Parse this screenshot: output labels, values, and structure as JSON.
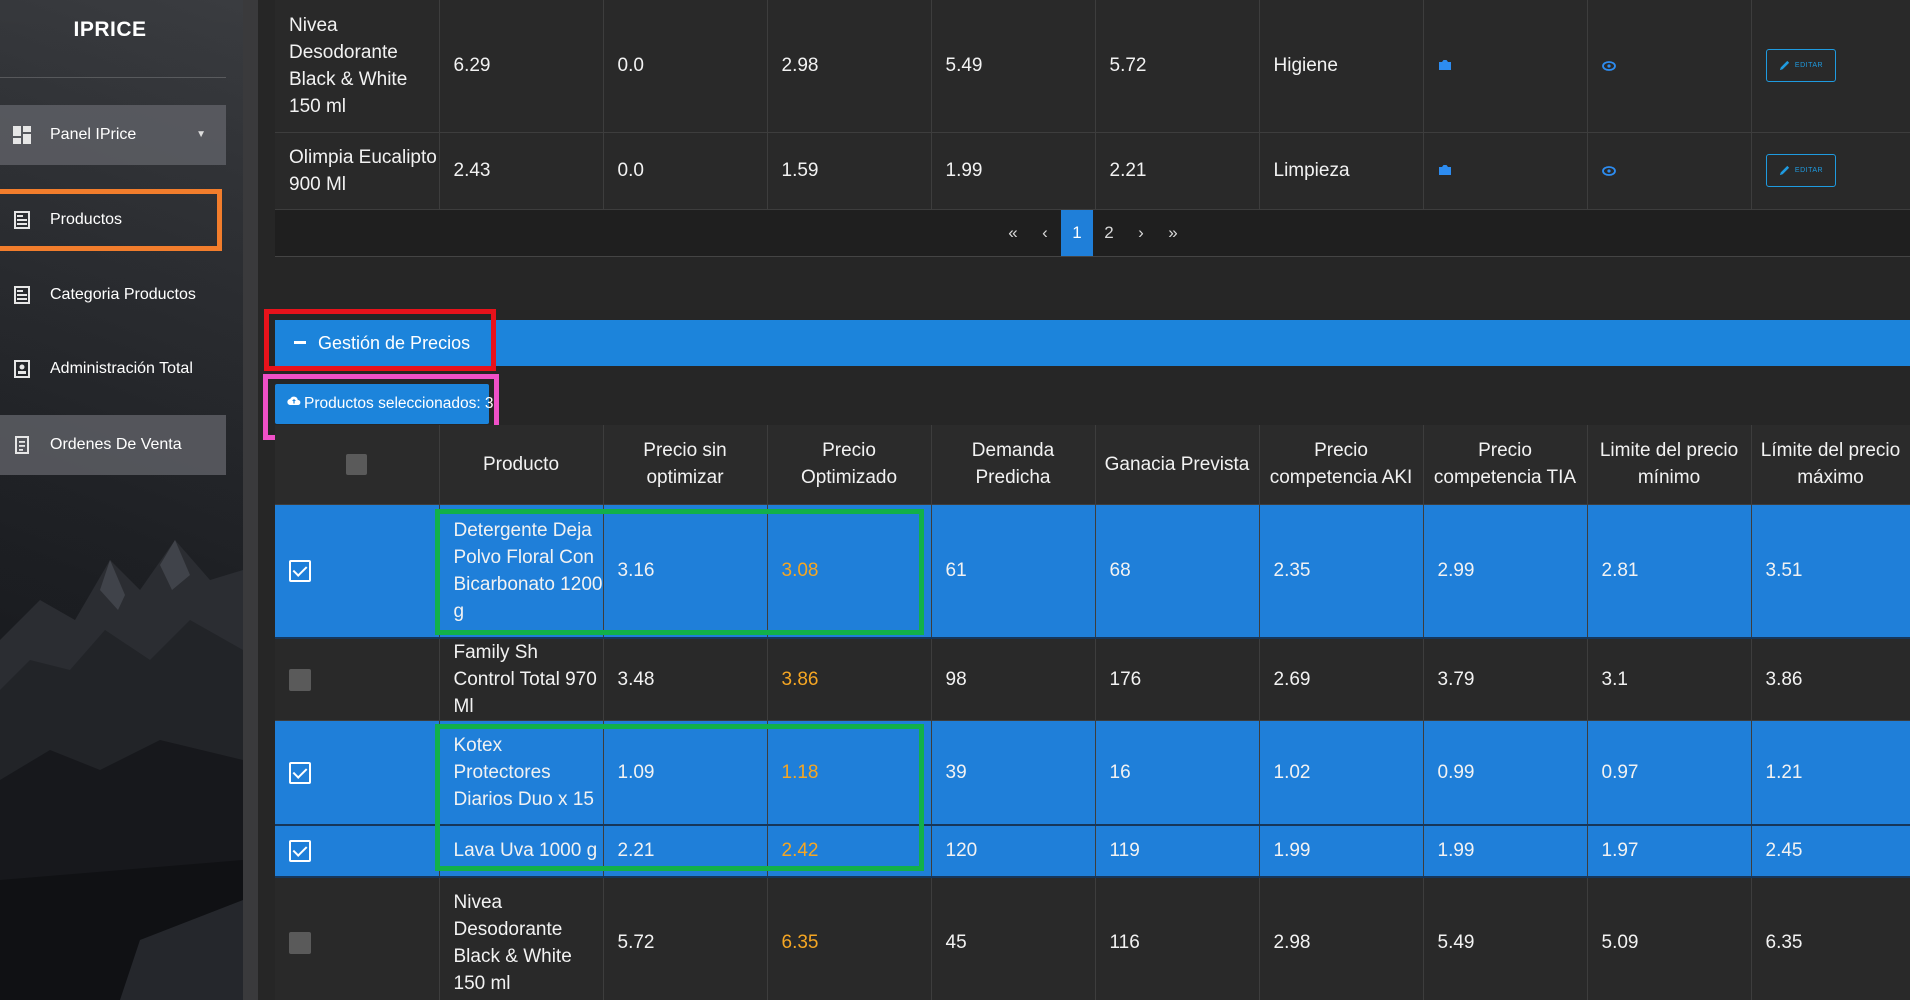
{
  "sidebar": {
    "brand": "IPRICE",
    "items": [
      {
        "label": "Panel IPrice",
        "icon": "dashboard-icon"
      },
      {
        "label": "Productos",
        "icon": "document-icon"
      },
      {
        "label": "Categoria Productos",
        "icon": "document-icon"
      },
      {
        "label": "Administración Total",
        "icon": "contact-card-icon"
      },
      {
        "label": "Ordenes De Venta",
        "icon": "receipt-icon"
      }
    ]
  },
  "top_table": {
    "rows": [
      {
        "producto": "Nivea Desodorante Black & White 150 ml",
        "c1": "6.29",
        "c2": "0.0",
        "c3": "2.98",
        "c4": "5.49",
        "c5": "5.72",
        "categoria": "Higiene",
        "edit_label": "EDITAR"
      },
      {
        "producto": "Olimpia Eucalipto 900 Ml",
        "c1": "2.43",
        "c2": "0.0",
        "c3": "1.59",
        "c4": "1.99",
        "c5": "2.21",
        "categoria": "Limpieza",
        "edit_label": "EDITAR"
      }
    ]
  },
  "pagination": {
    "first": "«",
    "prev": "‹",
    "pages": [
      "1",
      "2"
    ],
    "current": "1",
    "next": "›",
    "last": "»"
  },
  "gestion": {
    "title": "Gestión de Precios",
    "selected_button": "Productos seleccionados: 3"
  },
  "bottom_table": {
    "headers": [
      "Producto",
      "Precio sin optimizar",
      "Precio Optimizado",
      "Demanda Predicha",
      "Ganacia Prevista",
      "Precio competencia AKI",
      "Precio competencia TIA",
      "Limite del precio mínimo",
      "Límite del precio máximo"
    ],
    "rows": [
      {
        "checked": true,
        "producto": "Detergente Deja Polvo Floral Con Bicarbonato 1200 g",
        "sin_opt": "3.16",
        "opt": "3.08",
        "demanda": "61",
        "ganancia": "68",
        "aki": "2.35",
        "tia": "2.99",
        "min": "2.81",
        "max": "3.51"
      },
      {
        "checked": false,
        "producto": "Family Sh Control Total 970 Ml",
        "sin_opt": "3.48",
        "opt": "3.86",
        "demanda": "98",
        "ganancia": "176",
        "aki": "2.69",
        "tia": "3.79",
        "min": "3.1",
        "max": "3.86"
      },
      {
        "checked": true,
        "producto": "Kotex Protectores Diarios Duo x 15",
        "sin_opt": "1.09",
        "opt": "1.18",
        "demanda": "39",
        "ganancia": "16",
        "aki": "1.02",
        "tia": "0.99",
        "min": "0.97",
        "max": "1.21"
      },
      {
        "checked": true,
        "producto": "Lava Uva 1000 g",
        "sin_opt": "2.21",
        "opt": "2.42",
        "demanda": "120",
        "ganancia": "119",
        "aki": "1.99",
        "tia": "1.99",
        "min": "1.97",
        "max": "2.45"
      },
      {
        "checked": false,
        "producto": "Nivea Desodorante Black & White 150 ml",
        "sin_opt": "5.72",
        "opt": "6.35",
        "demanda": "45",
        "ganancia": "116",
        "aki": "2.98",
        "tia": "5.49",
        "min": "5.09",
        "max": "6.35"
      }
    ]
  },
  "colors": {
    "accent_blue": "#1f7fd9",
    "highlight_orange": "#f27d2c",
    "highlight_red": "#e8121b",
    "highlight_pink": "#f050c8",
    "highlight_green": "#12b04a",
    "optimized_price": "#f5a623"
  }
}
